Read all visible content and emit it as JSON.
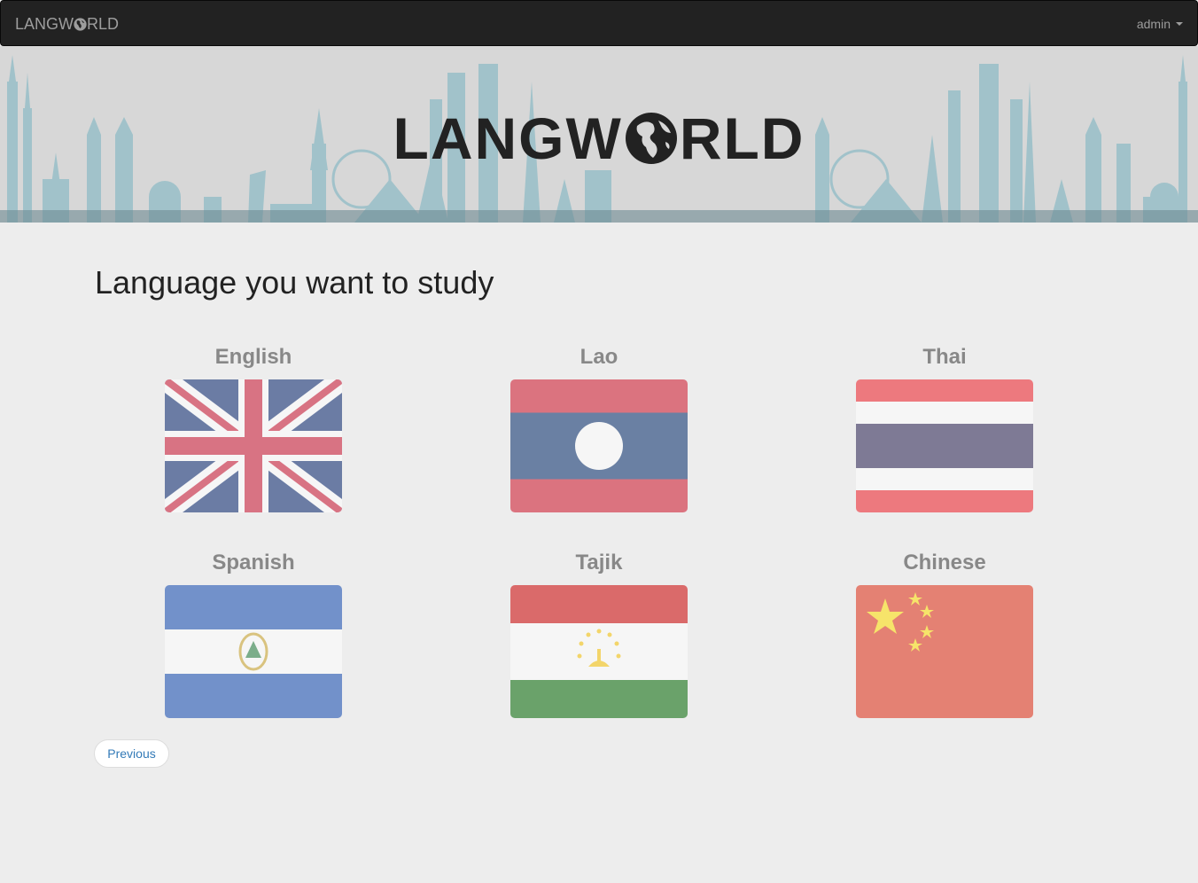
{
  "navbar": {
    "brand_prefix": "LANGW",
    "brand_suffix": "RLD",
    "user_label": "admin"
  },
  "banner": {
    "logo_prefix": "LANGW",
    "logo_suffix": "RLD"
  },
  "main": {
    "title": "Language you want to study",
    "languages": [
      {
        "name": "English",
        "flag": "uk-flag"
      },
      {
        "name": "Lao",
        "flag": "laos-flag"
      },
      {
        "name": "Thai",
        "flag": "thailand-flag"
      },
      {
        "name": "Spanish",
        "flag": "el-salvador-flag"
      },
      {
        "name": "Tajik",
        "flag": "tajikistan-flag"
      },
      {
        "name": "Chinese",
        "flag": "china-flag"
      }
    ],
    "previous_label": "Previous"
  },
  "colors": {
    "navbar_bg": "#222222",
    "navbar_text": "#9d9d9d",
    "page_bg": "#ededed",
    "link": "#337ab7",
    "skyline": "#7fb2bd"
  }
}
